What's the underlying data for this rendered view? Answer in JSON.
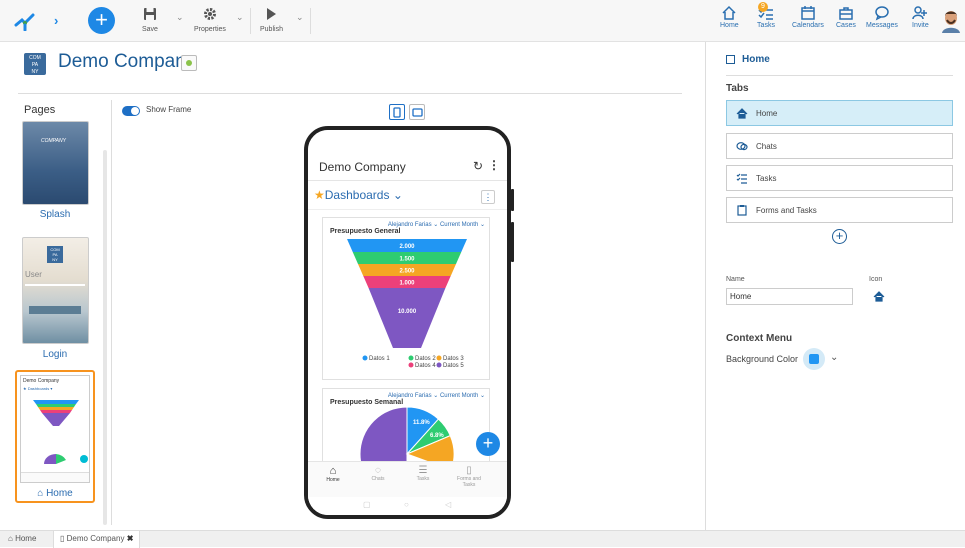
{
  "toolbar": {
    "save_label": "Save",
    "properties_label": "Properties",
    "publish_label": "Publish"
  },
  "topnav": [
    {
      "label": "Home",
      "icon": "home-icon"
    },
    {
      "label": "Tasks",
      "icon": "tasks-icon",
      "badge": "9"
    },
    {
      "label": "Calendars",
      "icon": "calendar-icon"
    },
    {
      "label": "Cases",
      "icon": "cases-icon"
    },
    {
      "label": "Messages",
      "icon": "messages-icon"
    },
    {
      "label": "Invite",
      "icon": "invite-icon"
    }
  ],
  "app": {
    "title": "Demo Company",
    "logo_text": "COMPANY"
  },
  "pages": {
    "heading": "Pages",
    "items": [
      {
        "label": "Splash"
      },
      {
        "label": "Login"
      },
      {
        "label": "Home"
      }
    ]
  },
  "design": {
    "show_frame_label": "Show Frame",
    "show_frame_on": true
  },
  "phone": {
    "app_title": "Demo Company",
    "dashboards_label": "Dashboards",
    "card1": {
      "owner": "Alejandro Farias",
      "period": "Current Month",
      "title": "Presupuesto General"
    },
    "card2": {
      "owner": "Alejandro Farias",
      "period": "Current Month",
      "title": "Presupuesto Semanal"
    },
    "bottom_nav": [
      "Home",
      "Chats",
      "Tasks",
      "Forms and Tasks"
    ]
  },
  "chart_data": [
    {
      "type": "funnel",
      "title": "Presupuesto General",
      "categories": [
        "Datos 1",
        "Datos 2",
        "Datos 3",
        "Datos 4",
        "Datos 5"
      ],
      "values_labels": [
        "2.000",
        "1.500",
        "2.500",
        "1.000",
        "10.000"
      ],
      "colors": [
        "#2196f3",
        "#2ecc71",
        "#f5a623",
        "#ec407a",
        "#7e57c2"
      ]
    },
    {
      "type": "pie",
      "title": "Presupuesto Semanal",
      "labels": [
        "11.8%",
        "6.8%"
      ],
      "colors": [
        "#7e57c2",
        "#2196f3",
        "#2ecc71"
      ]
    }
  ],
  "right_panel": {
    "title": "Home",
    "tabs_heading": "Tabs",
    "tabs": [
      "Home",
      "Chats",
      "Tasks",
      "Forms and Tasks"
    ],
    "name_label": "Name",
    "icon_label": "Icon",
    "name_value": "Home",
    "context_menu_heading": "Context Menu",
    "bg_color_label": "Background Color",
    "bg_color_value": "#2196f3"
  },
  "status_tabs": [
    {
      "label": "Home"
    },
    {
      "label": "Demo Company"
    }
  ]
}
